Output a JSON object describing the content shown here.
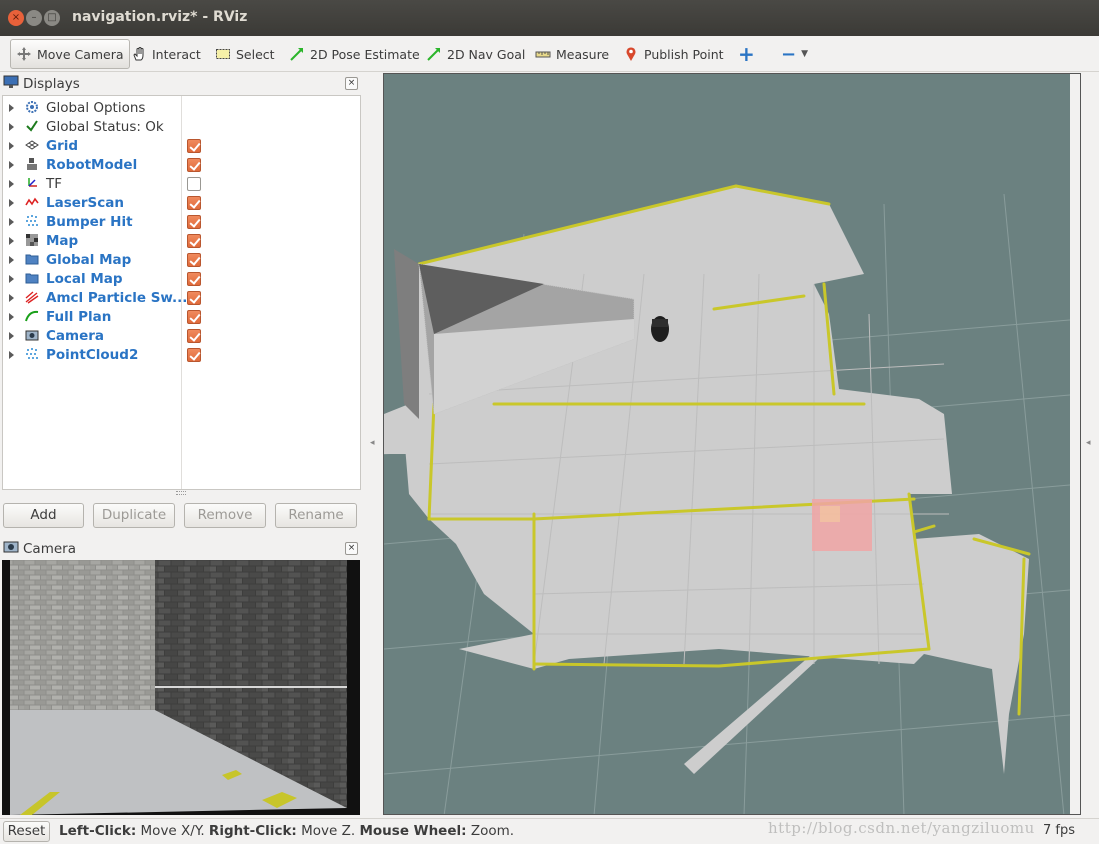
{
  "window": {
    "title": "navigation.rviz* - RViz",
    "close_glyph": "×",
    "minimize_glyph": "–",
    "maximize_glyph": "□"
  },
  "toolbar": {
    "tools": [
      {
        "label": "Move Camera",
        "icon": "move-camera-icon",
        "active": true
      },
      {
        "label": "Interact",
        "icon": "hand-icon",
        "active": false
      },
      {
        "label": "Select",
        "icon": "select-box-icon",
        "active": false
      },
      {
        "label": "2D Pose Estimate",
        "icon": "green-arrow-icon",
        "active": false
      },
      {
        "label": "2D Nav Goal",
        "icon": "green-arrow-icon",
        "active": false
      },
      {
        "label": "Measure",
        "icon": "ruler-icon",
        "active": false
      },
      {
        "label": "Publish Point",
        "icon": "map-pin-icon",
        "active": false
      }
    ],
    "add_tool_glyph": "+",
    "remove_tool_glyph": "−"
  },
  "displays": {
    "title": "Displays",
    "close_glyph": "×",
    "items": [
      {
        "label": "Global Options",
        "icon": "gear-icon",
        "checkbox": null,
        "plugin": false
      },
      {
        "label": "Global Status: Ok",
        "icon": "checkmark-icon",
        "checkbox": null,
        "plugin": false
      },
      {
        "label": "Grid",
        "icon": "grid-icon",
        "checkbox": true,
        "plugin": true
      },
      {
        "label": "RobotModel",
        "icon": "robot-icon",
        "checkbox": true,
        "plugin": true
      },
      {
        "label": "TF",
        "icon": "axes-icon",
        "checkbox": false,
        "plugin": false
      },
      {
        "label": "LaserScan",
        "icon": "laser-icon",
        "checkbox": true,
        "plugin": true
      },
      {
        "label": "Bumper Hit",
        "icon": "pointcloud-icon",
        "checkbox": true,
        "plugin": true
      },
      {
        "label": "Map",
        "icon": "map-icon",
        "checkbox": true,
        "plugin": true
      },
      {
        "label": "Global Map",
        "icon": "folder-icon",
        "checkbox": true,
        "plugin": true
      },
      {
        "label": "Local Map",
        "icon": "folder-icon",
        "checkbox": true,
        "plugin": true
      },
      {
        "label": "Amcl Particle Sw...",
        "icon": "pose-array-icon",
        "checkbox": true,
        "plugin": true
      },
      {
        "label": "Full Plan",
        "icon": "path-icon",
        "checkbox": true,
        "plugin": true
      },
      {
        "label": "Camera",
        "icon": "camera-icon",
        "checkbox": true,
        "plugin": true
      },
      {
        "label": "PointCloud2",
        "icon": "pointcloud-icon",
        "checkbox": true,
        "plugin": true
      }
    ],
    "buttons": {
      "add": "Add",
      "duplicate": "Duplicate",
      "remove": "Remove",
      "rename": "Rename"
    }
  },
  "camera_panel": {
    "title": "Camera",
    "close_glyph": "×"
  },
  "status": {
    "reset": "Reset",
    "left_click_key": "Left-Click:",
    "left_click_val": "Move X/Y.",
    "right_click_key": "Right-Click:",
    "right_click_val": "Move Z.",
    "wheel_key": "Mouse Wheel:",
    "wheel_val": "Zoom.",
    "fps": "7 fps",
    "watermark": "http://blog.csdn.net/yangziluomu"
  },
  "colors": {
    "view_background": "#6b8180",
    "map_free": "#cfcfcf",
    "map_wall": "#c9c72a",
    "plugin_label": "#2a74c4",
    "checkbox_on": "#e8764a"
  }
}
